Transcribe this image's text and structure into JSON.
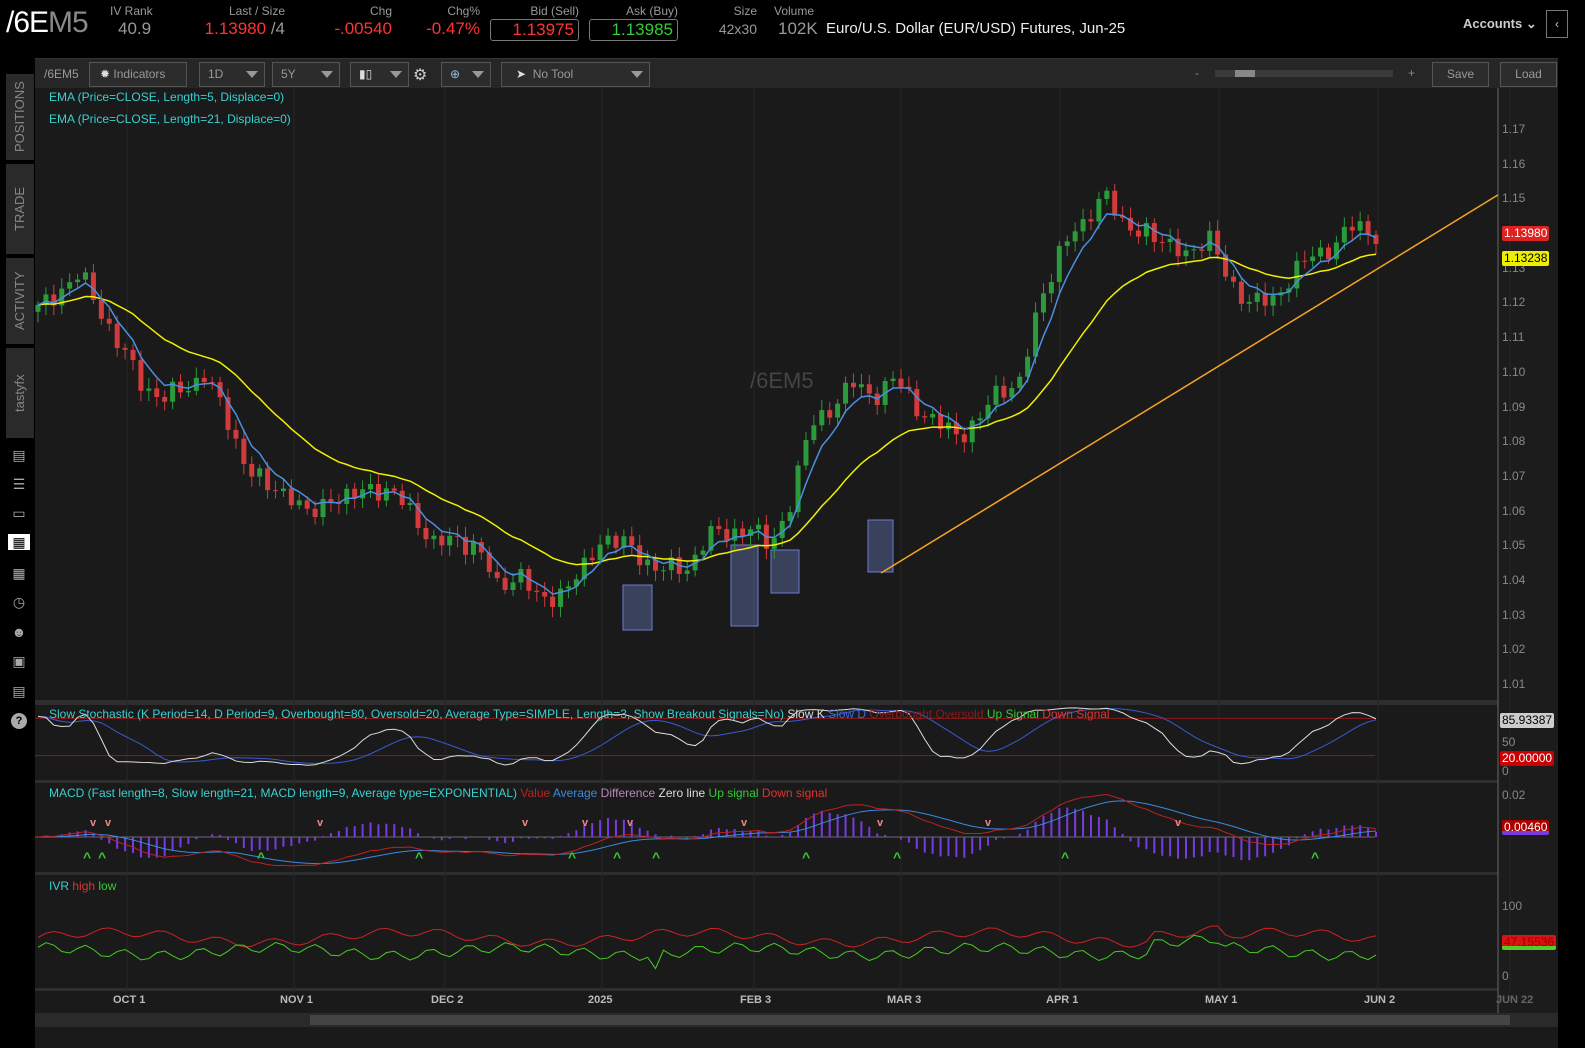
{
  "header": {
    "symbol_main": "/6E",
    "symbol_suffix": "M5",
    "iv_rank_label": "IV Rank",
    "iv_rank": "40.9",
    "last_label": "Last / Size",
    "last": "1.13980",
    "size": " /4",
    "chg_label": "Chg",
    "chg": "-.00540",
    "chgpct_label": "Chg%",
    "chgpct": "-0.47%",
    "bid_label": "Bid (Sell)",
    "bid": "1.13975",
    "ask_label": "Ask (Buy)",
    "ask": "1.13985",
    "sz_label": "Size",
    "sz": "42x30",
    "vol_label": "Volume",
    "vol": "102K",
    "description": "Euro/U.S. Dollar (EUR/USD) Futures, Jun-25",
    "accounts": "Accounts"
  },
  "sidebar": {
    "tabs": [
      "POSITIONS",
      "TRADE",
      "ACTIVITY",
      "tastyfx"
    ],
    "icons": [
      "news-icon",
      "list-icon",
      "tv-icon",
      "chart-icon",
      "grid-icon",
      "clock-icon",
      "community-icon",
      "calendar-icon",
      "fx-icon",
      "help-icon"
    ]
  },
  "toolbar": {
    "symbol": "/6EM5",
    "indicators": "Indicators",
    "aggregation": "1D",
    "period": "5Y",
    "tool": "No Tool",
    "zoom_minus": "-",
    "zoom_plus": "+",
    "save": "Save",
    "load": "Load",
    "zoom_level": 0.15
  },
  "studies": {
    "ema5": "EMA (Price=CLOSE, Length=5, Displace=0)",
    "ema21": "EMA (Price=CLOSE, Length=21, Displace=0)",
    "watermark": "/6EM5",
    "stoch": {
      "title": "Slow Stochastic (K Period=14, D Period=9, Overbought=80, Oversold=20, Average Type=SIMPLE, Length=3, Show Breakout Signals=No)",
      "k": "Slow K",
      "d": "Slow D",
      "ob": "Overbought",
      "os": "Oversold",
      "up": "Up Signal",
      "down": "Down Signal",
      "tag": "85.93387",
      "tag2": "20.00000",
      "ax50": "50",
      "ax0": "0"
    },
    "macd": {
      "title": "MACD (Fast length=8, Slow length=21, MACD length=9, Average type=EXPONENTIAL)",
      "value": "Value",
      "avg": "Average",
      "diff": "Difference",
      "zero": "Zero line",
      "up": "Up signal",
      "down": "Down signal",
      "tag": "0.00460",
      "ax": "0.02"
    },
    "ivr": {
      "title": "IVR",
      "high": "high",
      "low": "low",
      "tag": "47.15536",
      "ax100": "100",
      "ax0": "0"
    }
  },
  "price_axis": {
    "ticks": [
      "1.17",
      "1.16",
      "1.15",
      "1.14",
      "1.13",
      "1.12",
      "1.11",
      "1.10",
      "1.09",
      "1.08",
      "1.07",
      "1.06",
      "1.05",
      "1.04",
      "1.03",
      "1.02",
      "1.01"
    ],
    "last_tag": "1.13980",
    "ema_tag": "1.13238"
  },
  "date_axis": [
    "OCT 1",
    "NOV 1",
    "DEC 2",
    "2025",
    "FEB 3",
    "MAR 3",
    "APR 1",
    "MAY 1",
    "JUN 2",
    "JUN 22"
  ],
  "chart_data": {
    "type": "candlestick",
    "ylim": [
      1.0,
      1.175
    ],
    "close_path": [
      1.1178,
      1.1236,
      1.1279,
      1.1178,
      1.1063,
      1.0962,
      1.0925,
      1.0948,
      1.1,
      1.0861,
      1.0731,
      1.0659,
      1.0659,
      1.0573,
      1.0645,
      1.0631,
      1.0674,
      1.0645,
      1.0587,
      1.0501,
      1.0515,
      1.0501,
      1.0371,
      1.0429,
      1.0328,
      1.0371,
      1.0414,
      1.053,
      1.0501,
      1.0458,
      1.0429,
      1.0429,
      1.053,
      1.053,
      1.0559,
      1.0486,
      1.0631,
      1.0847,
      1.0904,
      1.0962,
      1.0933,
      1.0977,
      1.0904,
      1.0847,
      1.0818,
      1.0861,
      1.0948,
      1.0977,
      1.1207,
      1.138,
      1.1409,
      1.1539,
      1.1394,
      1.1423,
      1.1351,
      1.1351,
      1.138,
      1.1265,
      1.1193,
      1.1207,
      1.1279,
      1.1337,
      1.1366,
      1.1423,
      1.1398
    ],
    "trendline": [
      1.042,
      1.151
    ],
    "up_color": "#2a9a3a",
    "down_color": "#d23b3b",
    "ema5_color": "#4a90e2",
    "ema21_color": "#f0f000",
    "trend_color": "#f5a623"
  }
}
